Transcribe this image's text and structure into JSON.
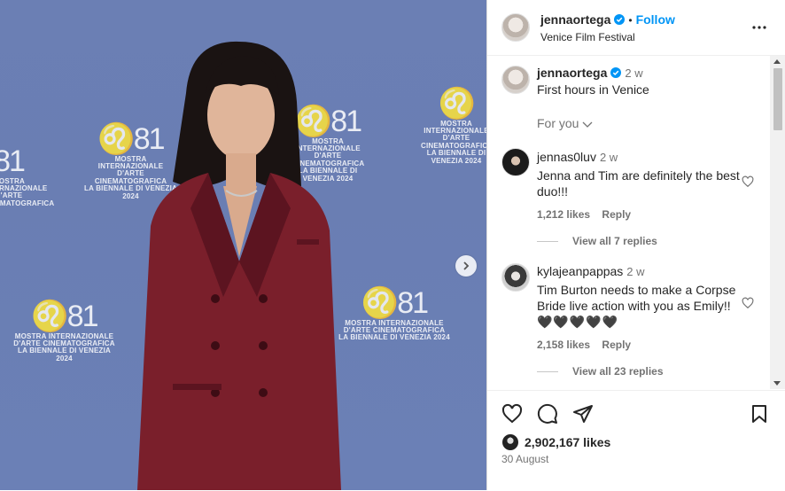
{
  "post": {
    "author": "jennaortega",
    "location": "Venice Film Festival",
    "follow_label": "Follow",
    "caption_author": "jennaortega",
    "caption": "First hours in Venice",
    "caption_time": "2 w",
    "for_you": "For you"
  },
  "photo": {
    "wall_text_1": "MOSTRA INTERNAZIONALE",
    "wall_text_2": "D'ARTE CINEMATOGRAFICA",
    "wall_text_3": "LA BIENNALE DI VENEZIA 2024",
    "wall_number": "81"
  },
  "comments": [
    {
      "user": "jennas0luv",
      "time": "2 w",
      "text": "Jenna and Tim are definitely the best duo!!!",
      "likes": "1,212 likes",
      "reply": "Reply",
      "view_replies": "View all 7 replies"
    },
    {
      "user": "kylajeanpappas",
      "time": "2 w",
      "text": "Tim Burton needs to make a Corpse Bride live action with you as Emily!!",
      "emoji": "🖤🖤🖤🖤🖤",
      "likes": "2,158 likes",
      "reply": "Reply",
      "view_replies": "View all 23 replies"
    }
  ],
  "footer": {
    "likes": "2,902,167 likes",
    "date": "30 August"
  },
  "colors": {
    "accent": "#0095f6",
    "backdrop": "#6b7fb4",
    "suit": "#7a1f2b"
  }
}
